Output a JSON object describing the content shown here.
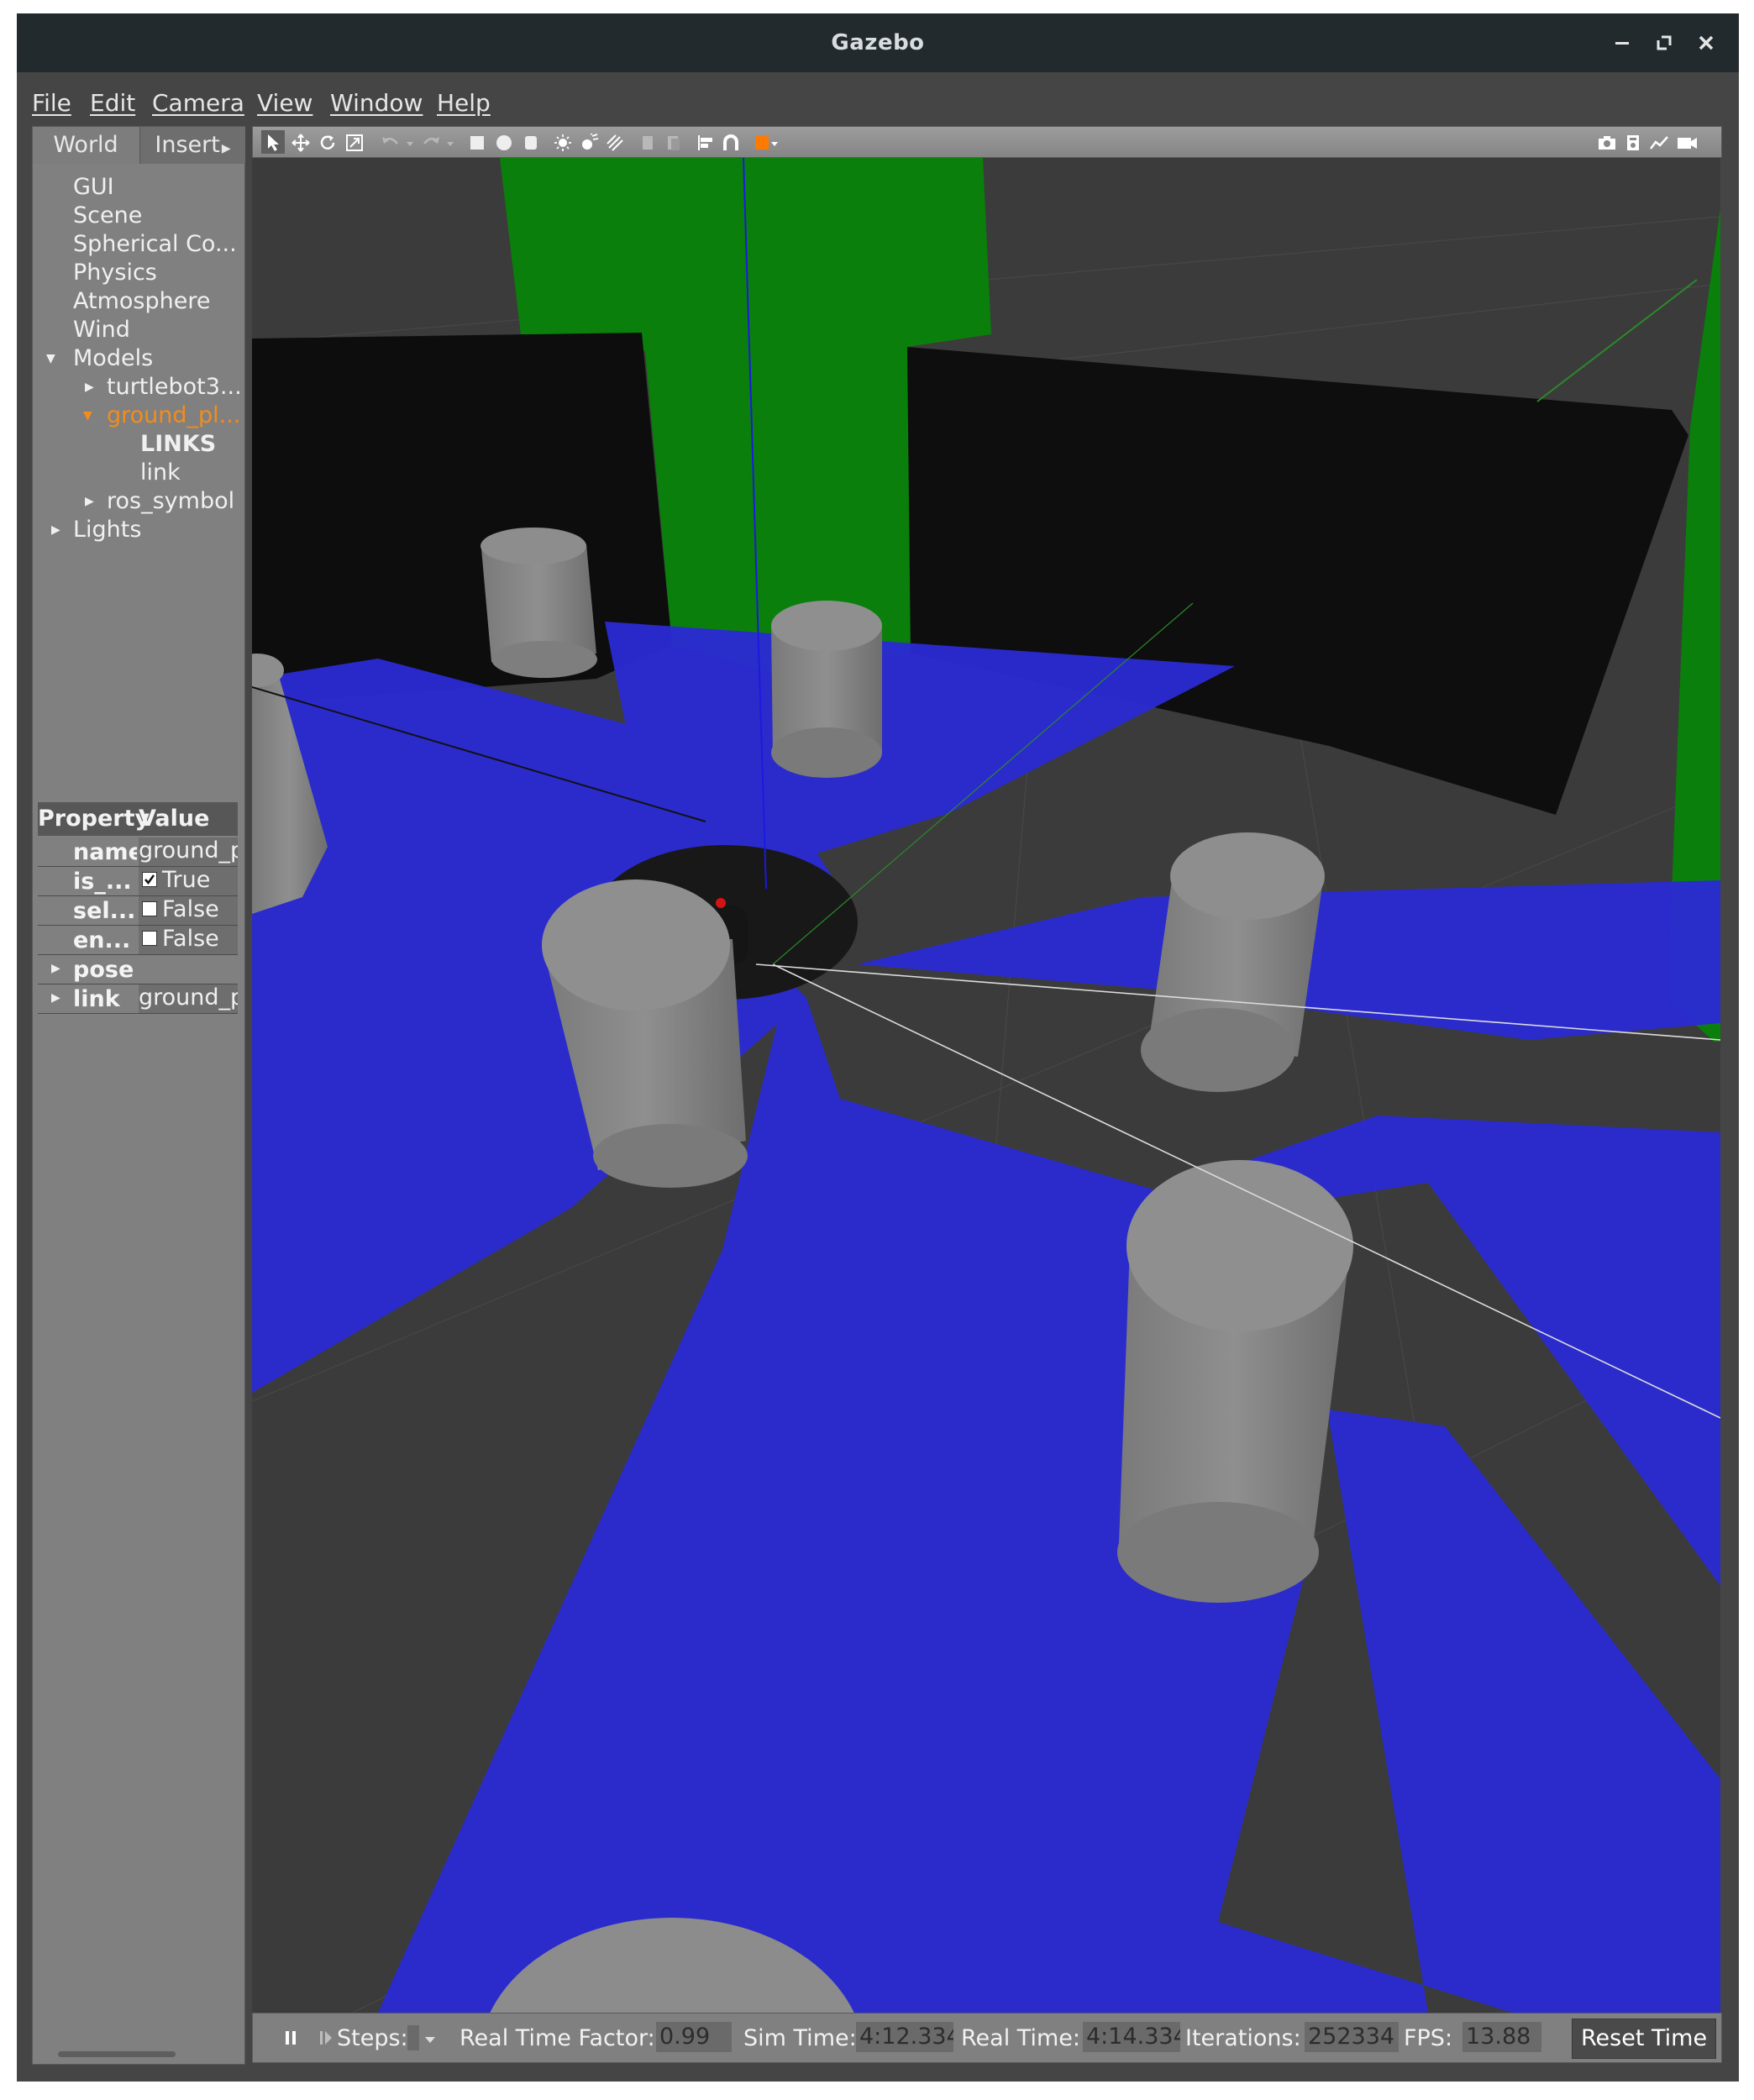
{
  "window": {
    "title": "Gazebo"
  },
  "menu": [
    "File",
    "Edit",
    "Camera",
    "View",
    "Window",
    "Help"
  ],
  "left_panel": {
    "tabs": [
      "World",
      "Insert"
    ],
    "tree": {
      "gui": "GUI",
      "scene": "Scene",
      "spherical": "Spherical Co...",
      "physics": "Physics",
      "atmosphere": "Atmosphere",
      "wind": "Wind",
      "models": "Models",
      "turtlebot": "turtlebot3...",
      "ground_plane": "ground_pl...",
      "links_header": "LINKS",
      "link": "link",
      "ros_symbol": "ros_symbol",
      "lights": "Lights"
    },
    "selected_color": "#f28c1c",
    "properties": {
      "header_property": "Property",
      "header_value": "Value",
      "rows": [
        {
          "key": "name",
          "value": "ground_p"
        },
        {
          "key": "is_...",
          "value": "True",
          "checked": true
        },
        {
          "key": "sel...",
          "value": "False",
          "checked": false
        },
        {
          "key": "en...",
          "value": "False",
          "checked": false
        },
        {
          "key": "pose",
          "value": ""
        },
        {
          "key": "link",
          "value": "ground_p"
        }
      ]
    }
  },
  "toolbar": {
    "left_tools": [
      "select-arrow-icon",
      "translate-icon",
      "rotate-icon",
      "scale-icon",
      "undo-icon",
      "redo-icon",
      "box-icon",
      "sphere-icon",
      "cylinder-icon",
      "point-light-icon",
      "spot-light-icon",
      "directional-light-icon",
      "copy-icon",
      "paste-icon",
      "align-icon",
      "snap-icon",
      "view-angle-icon"
    ],
    "right_tools": [
      "screenshot-icon",
      "log-icon",
      "plot-icon",
      "video-icon"
    ]
  },
  "bottom_bar": {
    "steps_label": "Steps:",
    "rtf_label": "Real Time Factor:",
    "rtf_value": "0.99",
    "sim_time_label": "Sim Time:",
    "sim_time_value": "4:12.334",
    "real_time_label": "Real Time:",
    "real_time_value": "4:14.334",
    "iterations_label": "Iterations:",
    "iterations_value": "252334",
    "fps_label": "FPS:",
    "fps_value": "13.88",
    "reset_label": "Reset Time"
  },
  "colors": {
    "laser": "#2323d8",
    "wall": "#0e0e0e",
    "pillar": "#8a8a8a",
    "green_wall": "#0a7a0a",
    "ground": "#3c3c3c"
  }
}
